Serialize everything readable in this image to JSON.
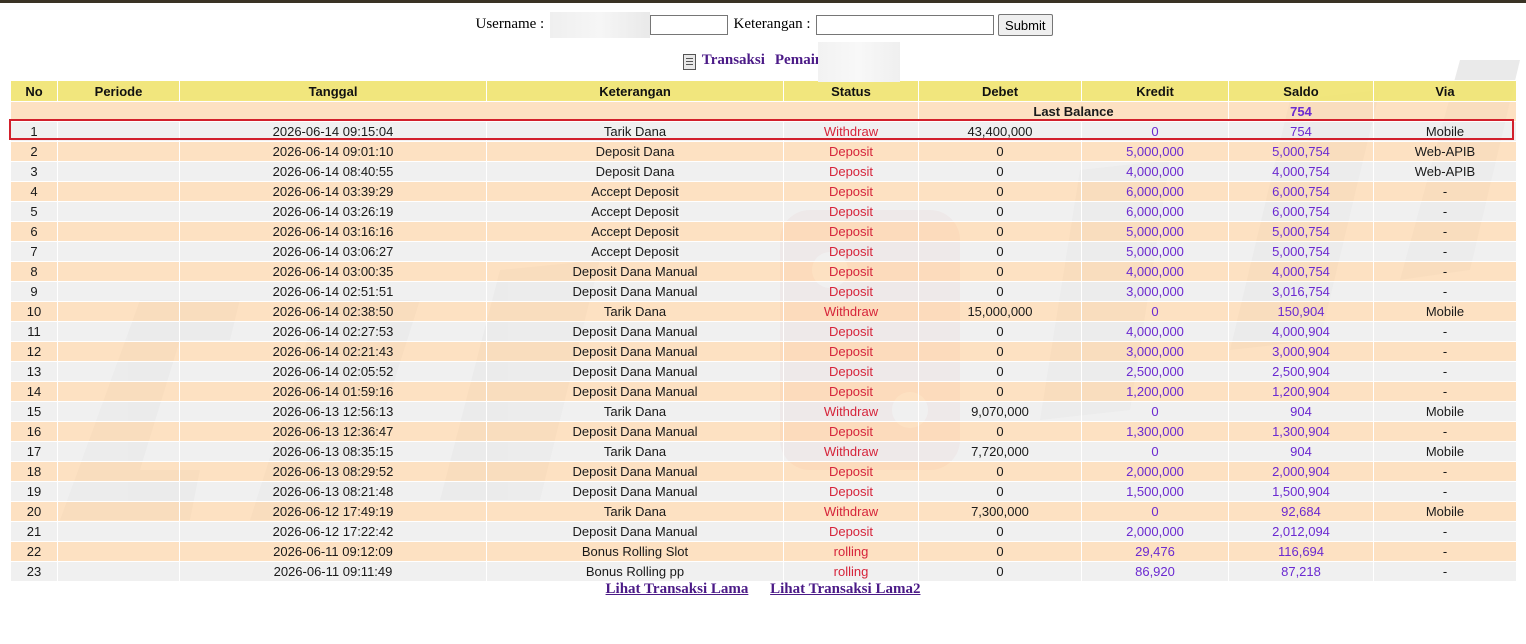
{
  "form": {
    "username_label": "Username :",
    "keterangan_label": "Keterangan :",
    "submit_label": "Submit"
  },
  "heading": {
    "transaksi": "Transaksi",
    "pemain": "Pemain : a"
  },
  "table": {
    "headers": [
      "No",
      "Periode",
      "Tanggal",
      "Keterangan",
      "Status",
      "Debet",
      "Kredit",
      "Saldo",
      "Via"
    ],
    "last_balance_label": "Last Balance",
    "last_balance_value": "754",
    "rows": [
      [
        "1",
        "",
        "2026-06-14 09:15:04",
        "Tarik Dana",
        "Withdraw",
        "43,400,000",
        "0",
        "754",
        "Mobile"
      ],
      [
        "2",
        "",
        "2026-06-14 09:01:10",
        "Deposit Dana",
        "Deposit",
        "0",
        "5,000,000",
        "5,000,754",
        "Web-APIB"
      ],
      [
        "3",
        "",
        "2026-06-14 08:40:55",
        "Deposit Dana",
        "Deposit",
        "0",
        "4,000,000",
        "4,000,754",
        "Web-APIB"
      ],
      [
        "4",
        "",
        "2026-06-14 03:39:29",
        "Accept Deposit",
        "Deposit",
        "0",
        "6,000,000",
        "6,000,754",
        "-"
      ],
      [
        "5",
        "",
        "2026-06-14 03:26:19",
        "Accept Deposit",
        "Deposit",
        "0",
        "6,000,000",
        "6,000,754",
        "-"
      ],
      [
        "6",
        "",
        "2026-06-14 03:16:16",
        "Accept Deposit",
        "Deposit",
        "0",
        "5,000,000",
        "5,000,754",
        "-"
      ],
      [
        "7",
        "",
        "2026-06-14 03:06:27",
        "Accept Deposit",
        "Deposit",
        "0",
        "5,000,000",
        "5,000,754",
        "-"
      ],
      [
        "8",
        "",
        "2026-06-14 03:00:35",
        "Deposit Dana Manual",
        "Deposit",
        "0",
        "4,000,000",
        "4,000,754",
        "-"
      ],
      [
        "9",
        "",
        "2026-06-14 02:51:51",
        "Deposit Dana Manual",
        "Deposit",
        "0",
        "3,000,000",
        "3,016,754",
        "-"
      ],
      [
        "10",
        "",
        "2026-06-14 02:38:50",
        "Tarik Dana",
        "Withdraw",
        "15,000,000",
        "0",
        "150,904",
        "Mobile"
      ],
      [
        "11",
        "",
        "2026-06-14 02:27:53",
        "Deposit Dana Manual",
        "Deposit",
        "0",
        "4,000,000",
        "4,000,904",
        "-"
      ],
      [
        "12",
        "",
        "2026-06-14 02:21:43",
        "Deposit Dana Manual",
        "Deposit",
        "0",
        "3,000,000",
        "3,000,904",
        "-"
      ],
      [
        "13",
        "",
        "2026-06-14 02:05:52",
        "Deposit Dana Manual",
        "Deposit",
        "0",
        "2,500,000",
        "2,500,904",
        "-"
      ],
      [
        "14",
        "",
        "2026-06-14 01:59:16",
        "Deposit Dana Manual",
        "Deposit",
        "0",
        "1,200,000",
        "1,200,904",
        "-"
      ],
      [
        "15",
        "",
        "2026-06-13 12:56:13",
        "Tarik Dana",
        "Withdraw",
        "9,070,000",
        "0",
        "904",
        "Mobile"
      ],
      [
        "16",
        "",
        "2026-06-13 12:36:47",
        "Deposit Dana Manual",
        "Deposit",
        "0",
        "1,300,000",
        "1,300,904",
        "-"
      ],
      [
        "17",
        "",
        "2026-06-13 08:35:15",
        "Tarik Dana",
        "Withdraw",
        "7,720,000",
        "0",
        "904",
        "Mobile"
      ],
      [
        "18",
        "",
        "2026-06-13 08:29:52",
        "Deposit Dana Manual",
        "Deposit",
        "0",
        "2,000,000",
        "2,000,904",
        "-"
      ],
      [
        "19",
        "",
        "2026-06-13 08:21:48",
        "Deposit Dana Manual",
        "Deposit",
        "0",
        "1,500,000",
        "1,500,904",
        "-"
      ],
      [
        "20",
        "",
        "2026-06-12 17:49:19",
        "Tarik Dana",
        "Withdraw",
        "7,300,000",
        "0",
        "92,684",
        "Mobile"
      ],
      [
        "21",
        "",
        "2026-06-12 17:22:42",
        "Deposit Dana Manual",
        "Deposit",
        "0",
        "2,000,000",
        "2,012,094",
        "-"
      ],
      [
        "22",
        "",
        "2026-06-11 09:12:09",
        "Bonus Rolling Slot",
        "rolling",
        "0",
        "29,476",
        "116,694",
        "-"
      ],
      [
        "23",
        "",
        "2026-06-11 09:11:49",
        "Bonus Rolling pp",
        "rolling",
        "0",
        "86,920",
        "87,218",
        "-"
      ]
    ]
  },
  "links": {
    "lama": "Lihat Transaksi Lama",
    "lama2": "Lihat Transaksi Lama2"
  },
  "colors": {
    "header_bg": "#f0e473",
    "row_odd": "#ececec",
    "row_even": "#fcdab4",
    "status_red": "#d6243a",
    "value_purple": "#6b2ad1",
    "link_purple": "#4b1a87",
    "highlight_red": "#d2202c"
  }
}
